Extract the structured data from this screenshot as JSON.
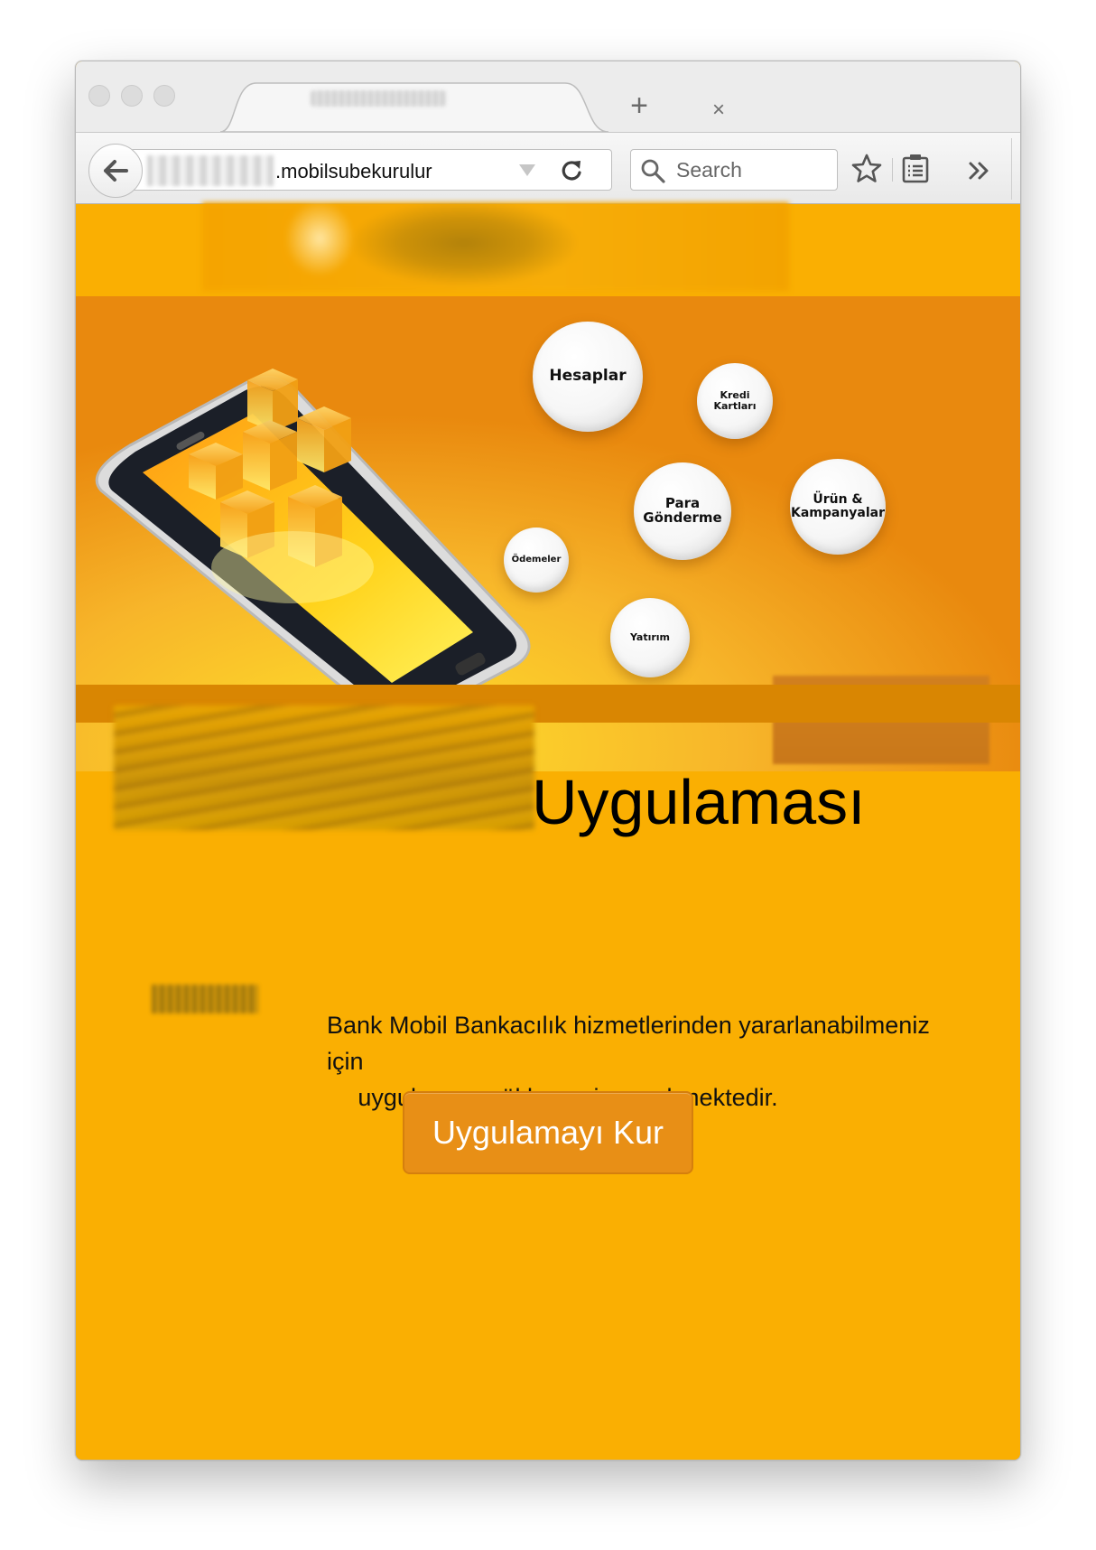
{
  "browser": {
    "tab": {
      "close_symbol": "×"
    },
    "new_tab_symbol": "+",
    "address": {
      "visible_text": ".mobilsubekurulur"
    },
    "search": {
      "placeholder": "Search"
    },
    "toolbar_icons": [
      "back-arrow-icon",
      "reload-icon",
      "search-icon",
      "star-icon",
      "reading-list-icon",
      "chevron-double-right-icon",
      "hamburger-menu-icon"
    ]
  },
  "banner": {
    "bubbles": {
      "hesaplar": "Hesaplar",
      "kredi_line1": "Kredi",
      "kredi_line2": "Kartları",
      "para_line1": "Para",
      "para_line2": "Gönderme",
      "urun_line1": "Ürün &",
      "urun_line2": "Kampanyalar",
      "odemeler": "Ödemeler",
      "yatirim": "Yatırım"
    }
  },
  "content": {
    "headline": "Uygulaması",
    "description_line1": "Bank Mobil Bankacılık hizmetlerinden yararlanabilmeniz için",
    "description_line2": "uygulamayı yüklemeniz gerekmektedir.",
    "install_button": "Uygulamayı Kur"
  },
  "colors": {
    "page_background": "#faaf02",
    "button_background": "#e88f16",
    "banner_background": "#ed8d10"
  }
}
